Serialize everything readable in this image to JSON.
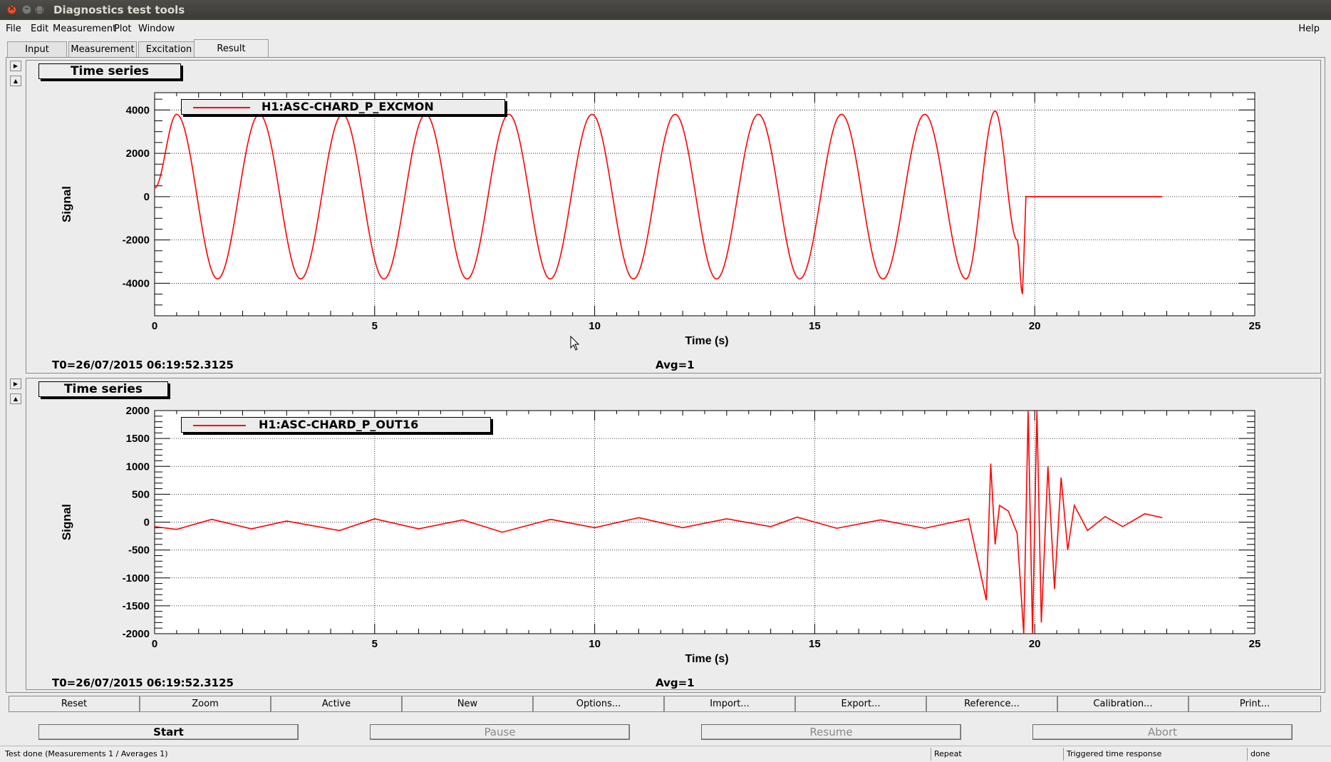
{
  "window": {
    "title": "Diagnostics test tools"
  },
  "menu": {
    "items": [
      "File",
      "Edit",
      "Measurement",
      "Plot",
      "Window"
    ],
    "help": "Help"
  },
  "tabs": [
    "Input",
    "Measurement",
    "Excitation",
    "Result"
  ],
  "active_tab": "Result",
  "plots": [
    {
      "panel_title": "Time series",
      "legend": "H1:ASC-CHARD_P_EXCMON",
      "t0": "T0=26/07/2015 06:19:52.3125",
      "avg": "Avg=1",
      "ylabel": "Signal",
      "xlabel": "Time (s)",
      "yticks": [
        "4000",
        "2000",
        "0",
        "-2000",
        "-4000"
      ],
      "xticks": [
        "0",
        "5",
        "10",
        "15",
        "20",
        "25"
      ]
    },
    {
      "panel_title": "Time series",
      "legend": "H1:ASC-CHARD_P_OUT16",
      "t0": "T0=26/07/2015 06:19:52.3125",
      "avg": "Avg=1",
      "ylabel": "Signal",
      "xlabel": "Time (s)",
      "yticks": [
        "2000",
        "1500",
        "1000",
        "500",
        "0",
        "-500",
        "-1000",
        "-1500",
        "-2000"
      ],
      "xticks": [
        "0",
        "5",
        "10",
        "15",
        "20",
        "25"
      ]
    }
  ],
  "chart_data": [
    {
      "type": "line",
      "xlabel": "Time (s)",
      "ylabel": "Signal",
      "xlim": [
        0,
        25
      ],
      "ylim": [
        -5500,
        4800
      ],
      "grid": true,
      "legend": "top-left",
      "series": [
        {
          "name": "H1:ASC-CHARD_P_EXCMON",
          "color": "#ff0000",
          "description_points": {
            "x": [
              0,
              0.5,
              1.43,
              2.38,
              3.32,
              4.27,
              5.21,
              6.16,
              7.1,
              8.05,
              8.99,
              9.94,
              10.88,
              11.83,
              12.77,
              13.72,
              14.66,
              15.61,
              16.55,
              17.5,
              18.44,
              19.1,
              19.6,
              19.72,
              19.75,
              19.8,
              22.9
            ],
            "y": [
              400,
              3800,
              -3800,
              3800,
              -3800,
              3800,
              -3800,
              3800,
              -3800,
              3800,
              -3800,
              3800,
              -3800,
              3800,
              -3800,
              3800,
              -3800,
              3800,
              -3800,
              3800,
              -3800,
              3950,
              -2000,
              -4500,
              -3000,
              0,
              0
            ]
          }
        }
      ]
    },
    {
      "type": "line",
      "xlabel": "Time (s)",
      "ylabel": "Signal",
      "xlim": [
        0,
        25
      ],
      "ylim": [
        -2000,
        2000
      ],
      "grid": true,
      "legend": "top-left",
      "series": [
        {
          "name": "H1:ASC-CHARD_P_OUT16",
          "color": "#ff0000",
          "description_points": {
            "x": [
              0,
              0.5,
              1.3,
              2.2,
              3.0,
              4.2,
              5.0,
              6.0,
              7.0,
              7.9,
              9.0,
              10.0,
              11.0,
              12.0,
              13.0,
              14.0,
              14.6,
              15.5,
              16.5,
              17.5,
              18.5,
              18.9,
              19.0,
              19.1,
              19.2,
              19.4,
              19.6,
              19.75,
              19.85,
              19.95,
              20.05,
              20.15,
              20.3,
              20.45,
              20.6,
              20.75,
              20.9,
              21.2,
              21.6,
              22.0,
              22.5,
              22.9
            ],
            "y": [
              -80,
              -130,
              50,
              -120,
              20,
              -150,
              60,
              -120,
              40,
              -180,
              50,
              -100,
              80,
              -100,
              60,
              -80,
              90,
              -110,
              40,
              -110,
              60,
              -1400,
              1050,
              -400,
              300,
              200,
              -200,
              -2000,
              2000,
              -2000,
              2000,
              -1800,
              1000,
              -1200,
              800,
              -500,
              300,
              -150,
              100,
              -80,
              150,
              80
            ]
          }
        }
      ]
    }
  ],
  "action_buttons": [
    "Reset",
    "Zoom",
    "Active",
    "New",
    "Options...",
    "Import...",
    "Export...",
    "Reference...",
    "Calibration...",
    "Print..."
  ],
  "run_buttons": {
    "start": "Start",
    "pause": "Pause",
    "resume": "Resume",
    "abort": "Abort"
  },
  "status": {
    "message": "Test done (Measurements 1 / Averages 1)",
    "mode": "Repeat",
    "test_type": "Triggered time response",
    "state": "done"
  }
}
